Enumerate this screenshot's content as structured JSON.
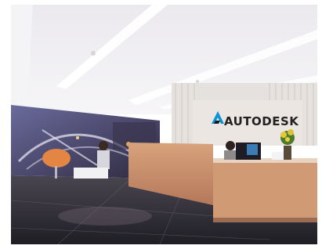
{
  "scene": {
    "type": "office-reception-lobby-photo",
    "sign_text": "AUTODESK",
    "logo_icon": "autodesk-a-logo-icon",
    "colors": {
      "ceiling": "#f2f1f3",
      "left_wall": "#f3f2f4",
      "mural_sky": "#5b5a86",
      "floor_dark": "#2a2930",
      "desk_wood": "#c9916a",
      "sign_panel": "#e8e2de",
      "accent_orange": "#e38543",
      "plant_yellow": "#d9c33a",
      "brand_teal": "#0696d7"
    }
  }
}
